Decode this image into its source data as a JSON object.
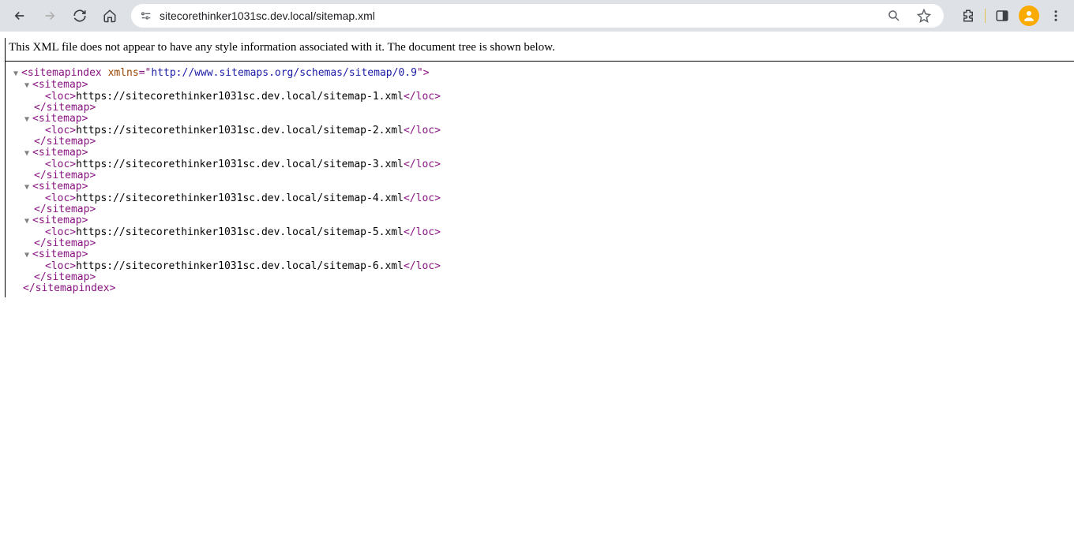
{
  "browser": {
    "url": "sitecorethinker1031sc.dev.local/sitemap.xml"
  },
  "notice": "This XML file does not appear to have any style information associated with it. The document tree is shown below.",
  "xml": {
    "root_tag": "sitemapindex",
    "xmlns_attr": "xmlns",
    "xmlns_value": "http://www.sitemaps.org/schemas/sitemap/0.9",
    "sitemap_tag": "sitemap",
    "loc_tag": "loc",
    "entries": [
      {
        "loc": "https://sitecorethinker1031sc.dev.local/sitemap-1.xml"
      },
      {
        "loc": "https://sitecorethinker1031sc.dev.local/sitemap-2.xml"
      },
      {
        "loc": "https://sitecorethinker1031sc.dev.local/sitemap-3.xml"
      },
      {
        "loc": "https://sitecorethinker1031sc.dev.local/sitemap-4.xml"
      },
      {
        "loc": "https://sitecorethinker1031sc.dev.local/sitemap-5.xml"
      },
      {
        "loc": "https://sitecorethinker1031sc.dev.local/sitemap-6.xml"
      }
    ]
  }
}
